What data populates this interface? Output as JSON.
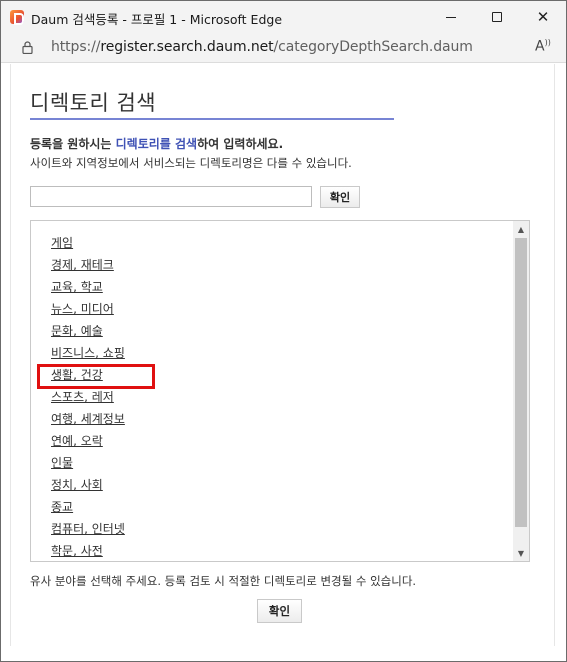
{
  "window": {
    "title": "Daum 검색등록 - 프로필 1 - Microsoft Edge",
    "minimize_icon": "minimize-icon",
    "maximize_icon": "maximize-icon",
    "close_icon": "close-icon"
  },
  "addressbar": {
    "url_scheme": "https://",
    "url_host": "register.search.daum.net",
    "url_path": "/categoryDepthSearch.daum",
    "lock_icon": "lock-icon",
    "read_aloud_icon": "read-aloud-icon"
  },
  "page": {
    "heading": "디렉토리 검색",
    "intro_bold_pre": "등록을 원하시는 ",
    "intro_bold_accent": "디렉토리를 검색",
    "intro_bold_post": "하여 입력하세요.",
    "intro_sub": "사이트와 지역정보에서 서비스되는 디렉토리명은 다를 수 있습니다.",
    "search": {
      "value": "",
      "button_label": "확인"
    },
    "categories": [
      "게임",
      "경제, 재테크",
      "교육, 학교",
      "뉴스, 미디어",
      "문화, 예술",
      "비즈니스, 쇼핑",
      "생활, 건강",
      "스포츠, 레저",
      "여행, 세계정보",
      "연예, 오락",
      "인물",
      "정치, 사회",
      "종교",
      "컴퓨터, 인터넷",
      "학문, 사전"
    ],
    "highlighted_category": "생활, 건강",
    "highlight_color": "#e01010",
    "accent_color": "#3f52b5",
    "footnote": "유사 분야를 선택해 주세요. 등록 검토 시 적절한 디렉토리로 변경될 수 있습니다.",
    "confirm_label": "확인"
  }
}
